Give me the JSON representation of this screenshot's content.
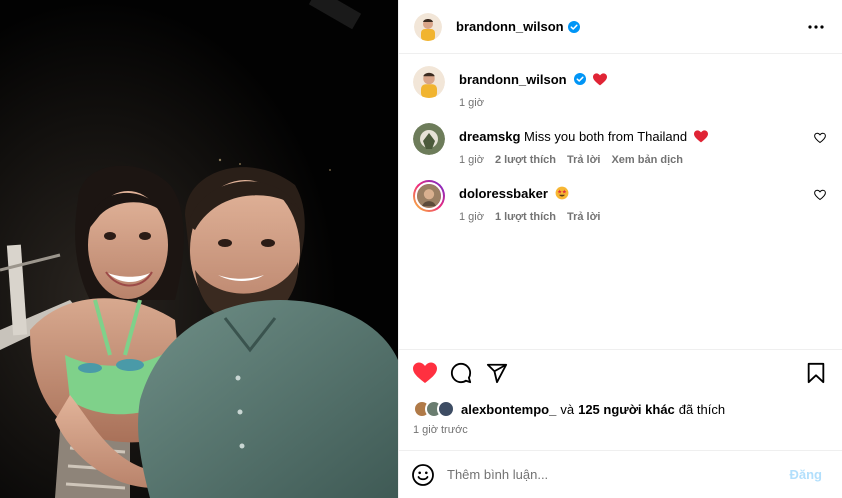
{
  "post": {
    "author": "brandonn_wilson",
    "author_verified": true
  },
  "header": {
    "username": "brandonn_wilson",
    "more_icon": "more-horizontal-icon"
  },
  "caption": {
    "username": "brandonn_wilson",
    "emoji": "red-heart",
    "time": "1 giờ"
  },
  "comments": [
    {
      "username": "dreamskg",
      "text": "Miss you both from Thailand",
      "emoji": "red-heart",
      "time": "1 giờ",
      "likes": "2 lượt thích",
      "reply": "Trả lời",
      "translate": "Xem bản dịch"
    },
    {
      "username": "doloressbaker",
      "text": "",
      "emoji": "star-struck",
      "time": "1 giờ",
      "likes": "1 lượt thích",
      "reply": "Trả lời",
      "has_story_ring": true
    }
  ],
  "actions": {
    "like": "heart-filled-icon",
    "comment": "comment-icon",
    "share": "send-icon",
    "save": "bookmark-icon",
    "liked": true
  },
  "likes_line": {
    "first_user": "alexbontempo_",
    "connector": "và",
    "others": "125 người khác",
    "suffix": "đã thích"
  },
  "posted_ago": "1 giờ trước",
  "composer": {
    "placeholder": "Thêm bình luận...",
    "post_label": "Đăng",
    "emoji_icon": "smiley-icon"
  },
  "colors": {
    "like_red": "#ff3040",
    "verified_blue": "#0095f6",
    "muted_text": "#737373",
    "post_disabled": "#b2dffc"
  }
}
